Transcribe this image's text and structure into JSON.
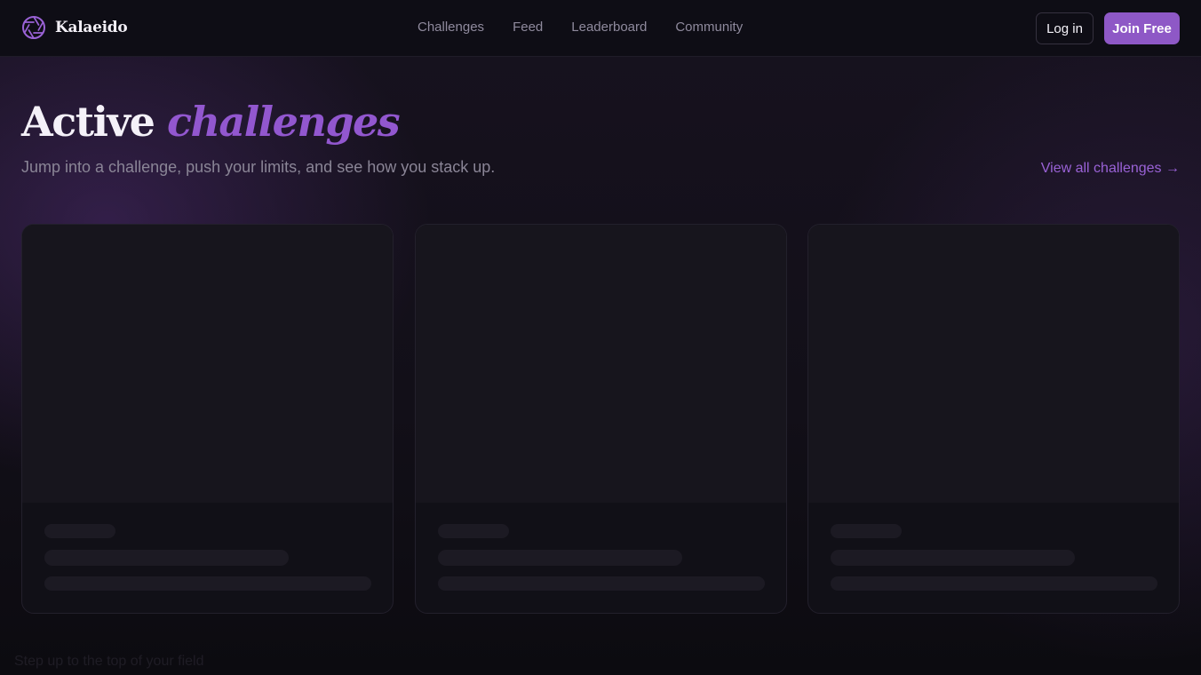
{
  "brand": {
    "name": "Kalaeido",
    "icon": "aperture-logo-icon",
    "accent_color": "#8e58c6"
  },
  "nav": {
    "links": [
      {
        "label": "Challenges"
      },
      {
        "label": "Feed"
      },
      {
        "label": "Leaderboard"
      },
      {
        "label": "Community"
      }
    ],
    "login_label": "Log in",
    "join_label": "Join Free"
  },
  "hero": {
    "title_plain": "Active",
    "title_accent": "challenges",
    "subtitle": "Jump into a challenge, push your limits, and see how you stack up.",
    "view_all": "View all challenges →"
  },
  "cards": [
    {
      "state": "loading"
    },
    {
      "state": "loading"
    },
    {
      "state": "loading"
    }
  ],
  "footer_partial": "Step up to the top of your field"
}
